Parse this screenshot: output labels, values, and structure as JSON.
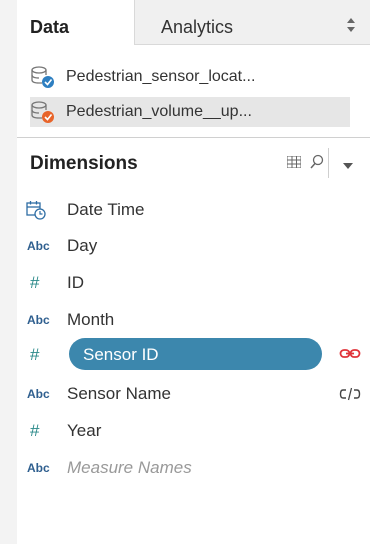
{
  "tabs": {
    "data_label": "Data",
    "analytics_label": "Analytics"
  },
  "data_sources": [
    {
      "label": "Pedestrian_sensor_locat...",
      "badge_color": "#2e7fc1"
    },
    {
      "label": "Pedestrian_volume__up...",
      "badge_color": "#e8642a",
      "selected": true
    }
  ],
  "dimensions": {
    "title": "Dimensions",
    "fields": [
      {
        "type": "date-time-icon",
        "label": "Date Time"
      },
      {
        "type": "Abc",
        "label": "Day"
      },
      {
        "type": "#",
        "label": "ID"
      },
      {
        "type": "Abc",
        "label": "Month"
      },
      {
        "type": "#",
        "label": "Sensor ID",
        "selected": true,
        "link": "active"
      },
      {
        "type": "Abc",
        "label": "Sensor Name",
        "link": "broken"
      },
      {
        "type": "#",
        "label": "Year"
      },
      {
        "type": "Abc",
        "label": "Measure Names",
        "italic": true
      }
    ]
  },
  "colors": {
    "selection": "#3c87ad",
    "link_active": "#e0343a",
    "accent_blue": "#2e6da4"
  }
}
